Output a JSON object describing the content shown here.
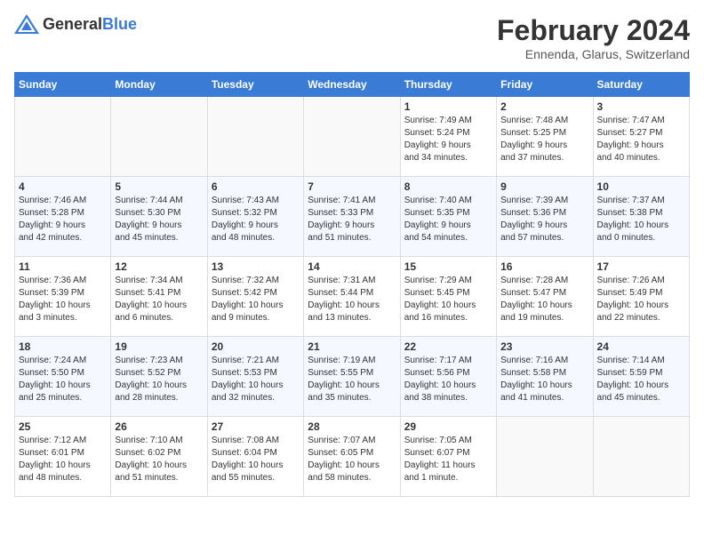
{
  "header": {
    "logo_general": "General",
    "logo_blue": "Blue",
    "main_title": "February 2024",
    "sub_title": "Ennenda, Glarus, Switzerland"
  },
  "weekdays": [
    "Sunday",
    "Monday",
    "Tuesday",
    "Wednesday",
    "Thursday",
    "Friday",
    "Saturday"
  ],
  "weeks": [
    [
      {
        "day": "",
        "info": ""
      },
      {
        "day": "",
        "info": ""
      },
      {
        "day": "",
        "info": ""
      },
      {
        "day": "",
        "info": ""
      },
      {
        "day": "1",
        "info": "Sunrise: 7:49 AM\nSunset: 5:24 PM\nDaylight: 9 hours\nand 34 minutes."
      },
      {
        "day": "2",
        "info": "Sunrise: 7:48 AM\nSunset: 5:25 PM\nDaylight: 9 hours\nand 37 minutes."
      },
      {
        "day": "3",
        "info": "Sunrise: 7:47 AM\nSunset: 5:27 PM\nDaylight: 9 hours\nand 40 minutes."
      }
    ],
    [
      {
        "day": "4",
        "info": "Sunrise: 7:46 AM\nSunset: 5:28 PM\nDaylight: 9 hours\nand 42 minutes."
      },
      {
        "day": "5",
        "info": "Sunrise: 7:44 AM\nSunset: 5:30 PM\nDaylight: 9 hours\nand 45 minutes."
      },
      {
        "day": "6",
        "info": "Sunrise: 7:43 AM\nSunset: 5:32 PM\nDaylight: 9 hours\nand 48 minutes."
      },
      {
        "day": "7",
        "info": "Sunrise: 7:41 AM\nSunset: 5:33 PM\nDaylight: 9 hours\nand 51 minutes."
      },
      {
        "day": "8",
        "info": "Sunrise: 7:40 AM\nSunset: 5:35 PM\nDaylight: 9 hours\nand 54 minutes."
      },
      {
        "day": "9",
        "info": "Sunrise: 7:39 AM\nSunset: 5:36 PM\nDaylight: 9 hours\nand 57 minutes."
      },
      {
        "day": "10",
        "info": "Sunrise: 7:37 AM\nSunset: 5:38 PM\nDaylight: 10 hours\nand 0 minutes."
      }
    ],
    [
      {
        "day": "11",
        "info": "Sunrise: 7:36 AM\nSunset: 5:39 PM\nDaylight: 10 hours\nand 3 minutes."
      },
      {
        "day": "12",
        "info": "Sunrise: 7:34 AM\nSunset: 5:41 PM\nDaylight: 10 hours\nand 6 minutes."
      },
      {
        "day": "13",
        "info": "Sunrise: 7:32 AM\nSunset: 5:42 PM\nDaylight: 10 hours\nand 9 minutes."
      },
      {
        "day": "14",
        "info": "Sunrise: 7:31 AM\nSunset: 5:44 PM\nDaylight: 10 hours\nand 13 minutes."
      },
      {
        "day": "15",
        "info": "Sunrise: 7:29 AM\nSunset: 5:45 PM\nDaylight: 10 hours\nand 16 minutes."
      },
      {
        "day": "16",
        "info": "Sunrise: 7:28 AM\nSunset: 5:47 PM\nDaylight: 10 hours\nand 19 minutes."
      },
      {
        "day": "17",
        "info": "Sunrise: 7:26 AM\nSunset: 5:49 PM\nDaylight: 10 hours\nand 22 minutes."
      }
    ],
    [
      {
        "day": "18",
        "info": "Sunrise: 7:24 AM\nSunset: 5:50 PM\nDaylight: 10 hours\nand 25 minutes."
      },
      {
        "day": "19",
        "info": "Sunrise: 7:23 AM\nSunset: 5:52 PM\nDaylight: 10 hours\nand 28 minutes."
      },
      {
        "day": "20",
        "info": "Sunrise: 7:21 AM\nSunset: 5:53 PM\nDaylight: 10 hours\nand 32 minutes."
      },
      {
        "day": "21",
        "info": "Sunrise: 7:19 AM\nSunset: 5:55 PM\nDaylight: 10 hours\nand 35 minutes."
      },
      {
        "day": "22",
        "info": "Sunrise: 7:17 AM\nSunset: 5:56 PM\nDaylight: 10 hours\nand 38 minutes."
      },
      {
        "day": "23",
        "info": "Sunrise: 7:16 AM\nSunset: 5:58 PM\nDaylight: 10 hours\nand 41 minutes."
      },
      {
        "day": "24",
        "info": "Sunrise: 7:14 AM\nSunset: 5:59 PM\nDaylight: 10 hours\nand 45 minutes."
      }
    ],
    [
      {
        "day": "25",
        "info": "Sunrise: 7:12 AM\nSunset: 6:01 PM\nDaylight: 10 hours\nand 48 minutes."
      },
      {
        "day": "26",
        "info": "Sunrise: 7:10 AM\nSunset: 6:02 PM\nDaylight: 10 hours\nand 51 minutes."
      },
      {
        "day": "27",
        "info": "Sunrise: 7:08 AM\nSunset: 6:04 PM\nDaylight: 10 hours\nand 55 minutes."
      },
      {
        "day": "28",
        "info": "Sunrise: 7:07 AM\nSunset: 6:05 PM\nDaylight: 10 hours\nand 58 minutes."
      },
      {
        "day": "29",
        "info": "Sunrise: 7:05 AM\nSunset: 6:07 PM\nDaylight: 11 hours\nand 1 minute."
      },
      {
        "day": "",
        "info": ""
      },
      {
        "day": "",
        "info": ""
      }
    ]
  ]
}
